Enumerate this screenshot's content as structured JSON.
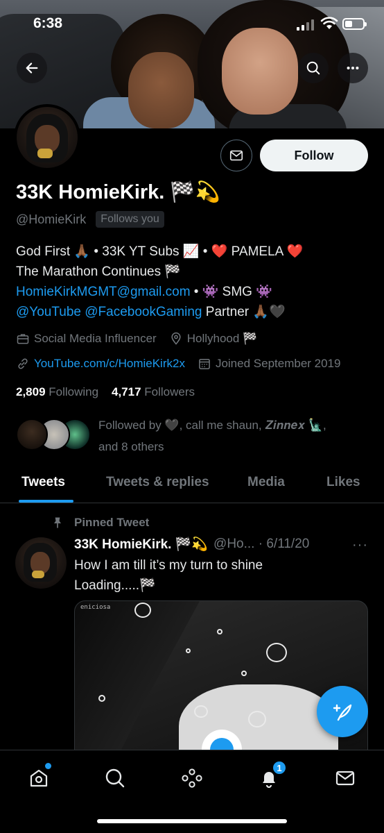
{
  "status_bar": {
    "time": "6:38"
  },
  "profile": {
    "display_name": "33K HomieKirk. 🏁💫",
    "handle": "@HomieKirk",
    "follows_you": "Follows you",
    "follow_button": "Follow",
    "bio_lines": [
      [
        {
          "text": "God First 🙏🏾 • 33K YT Subs 📈 • ❤️ PAMELA ❤️",
          "link": false
        }
      ],
      [
        {
          "text": "The Marathon Continues 🏁",
          "link": false
        }
      ],
      [
        {
          "text": "HomieKirkMGMT@gmail.com",
          "link": true
        },
        {
          "text": " • 👾 SMG 👾",
          "link": false
        }
      ],
      [
        {
          "text": "@YouTube",
          "link": true
        },
        {
          "text": " ",
          "link": false
        },
        {
          "text": "@FacebookGaming",
          "link": true
        },
        {
          "text": " Partner 🙏🏾🖤",
          "link": false
        }
      ]
    ],
    "category": "Social Media Influencer",
    "location": "Hollyhood 🏁",
    "website": "YouTube.com/c/HomieKirk2x",
    "joined": "Joined September 2019",
    "following_count": "2,809",
    "following_label": "Following",
    "followers_count": "4,717",
    "followers_label": "Followers",
    "followed_by_line1": "Followed by 🖤, call me shaun, 𝒁𝒊𝒏𝒏𝒆𝒙 🗽,",
    "followed_by_line2": "and 8 others"
  },
  "tabs": [
    "Tweets",
    "Tweets & replies",
    "Media",
    "Likes"
  ],
  "active_tab": "Tweets",
  "pinned_tweet": {
    "pinned_label": "Pinned Tweet",
    "author_name": "33K HomieKirk. 🏁💫",
    "author_meta": "@Ho... · 6/11/20",
    "more": "···",
    "text_line1": "How I am till it’s my turn to shine",
    "text_line2": "Loading.....🏁",
    "media_watermark": "eniciosa"
  },
  "bottom_nav": {
    "items": [
      "home-icon",
      "search-icon",
      "spaces-icon",
      "notifications-icon",
      "messages-icon"
    ],
    "notification_count": "1"
  },
  "colors": {
    "accent": "#1d9bf0",
    "background": "#000000",
    "muted": "#71767b"
  }
}
